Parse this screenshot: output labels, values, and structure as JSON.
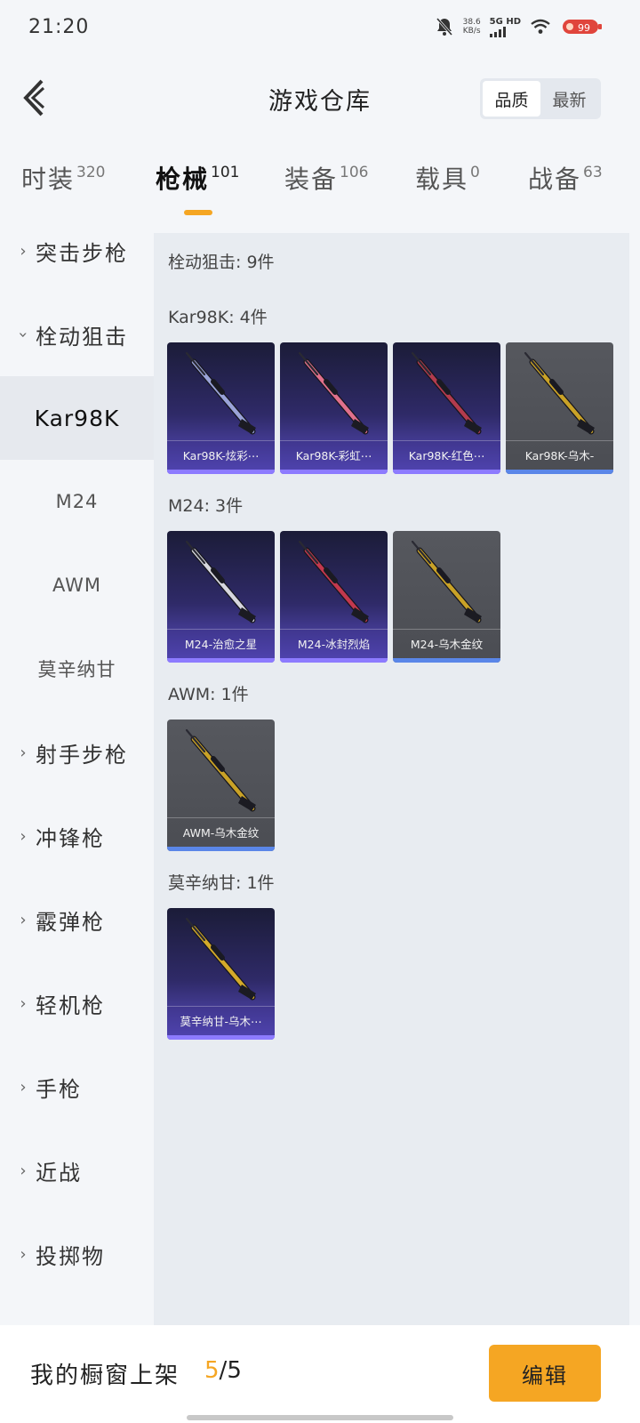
{
  "status_bar": {
    "time": "21:20",
    "net_speed_value": "38.6",
    "net_speed_unit": "KB/s",
    "network_type": "5G HD",
    "battery_level": "99"
  },
  "header": {
    "title": "游戏仓库",
    "sort_options": [
      "品质",
      "最新"
    ],
    "sort_selected": "品质"
  },
  "category_tabs": [
    {
      "label": "时装",
      "count": "320"
    },
    {
      "label": "枪械",
      "count": "101",
      "active": true
    },
    {
      "label": "装备",
      "count": "106"
    },
    {
      "label": "载具",
      "count": "0"
    },
    {
      "label": "战备",
      "count": "63"
    }
  ],
  "sidebar": {
    "items": [
      {
        "label": "突击步枪",
        "kind": "group",
        "expanded": false
      },
      {
        "label": "栓动狙击",
        "kind": "group",
        "expanded": true
      },
      {
        "label": "Kar98K",
        "kind": "sub",
        "selected": true
      },
      {
        "label": "M24",
        "kind": "sub"
      },
      {
        "label": "AWM",
        "kind": "sub"
      },
      {
        "label": "莫辛纳甘",
        "kind": "sub"
      },
      {
        "label": "射手步枪",
        "kind": "group",
        "expanded": false
      },
      {
        "label": "冲锋枪",
        "kind": "group",
        "expanded": false
      },
      {
        "label": "霰弹枪",
        "kind": "group",
        "expanded": false
      },
      {
        "label": "轻机枪",
        "kind": "group",
        "expanded": false
      },
      {
        "label": "手枪",
        "kind": "group",
        "expanded": false
      },
      {
        "label": "近战",
        "kind": "group",
        "expanded": false
      },
      {
        "label": "投掷物",
        "kind": "group",
        "expanded": false
      }
    ]
  },
  "content": {
    "category_summary": "栓动狙击: 9件",
    "groups": [
      {
        "title": "Kar98K: 4件",
        "items": [
          {
            "name": "Kar98K-炫彩⋯",
            "rarity": "purple",
            "gun_color": "#9aa3d8"
          },
          {
            "name": "Kar98K-彩虹⋯",
            "rarity": "purple",
            "gun_color": "#e0708c"
          },
          {
            "name": "Kar98K-红色⋯",
            "rarity": "purple",
            "gun_color": "#b23b4e"
          },
          {
            "name": "Kar98K-乌木-",
            "rarity": "gray",
            "gun_color": "#c9a227"
          }
        ]
      },
      {
        "title": "M24: 3件",
        "items": [
          {
            "name": "M24-治愈之星",
            "rarity": "purple",
            "gun_color": "#d6d6de"
          },
          {
            "name": "M24-冰封烈焰",
            "rarity": "purple",
            "gun_color": "#c2384e"
          },
          {
            "name": "M24-乌木金纹",
            "rarity": "gray",
            "gun_color": "#c9a227"
          }
        ]
      },
      {
        "title": "AWM: 1件",
        "items": [
          {
            "name": "AWM-乌木金纹",
            "rarity": "gray",
            "gun_color": "#c9a227"
          }
        ]
      },
      {
        "title": "莫辛纳甘: 1件",
        "items": [
          {
            "name": "莫辛纳甘-乌木⋯",
            "rarity": "purple",
            "gun_color": "#d4aa2a"
          }
        ]
      }
    ]
  },
  "bottom_bar": {
    "showcase_label": "我的橱窗上架",
    "showcase_used": "5",
    "showcase_sep": "/",
    "showcase_total": "5",
    "edit_label": "编辑"
  },
  "colors": {
    "accent": "#f5a623",
    "purple_card": "#2f2a68",
    "gray_card": "#4b4d53"
  }
}
